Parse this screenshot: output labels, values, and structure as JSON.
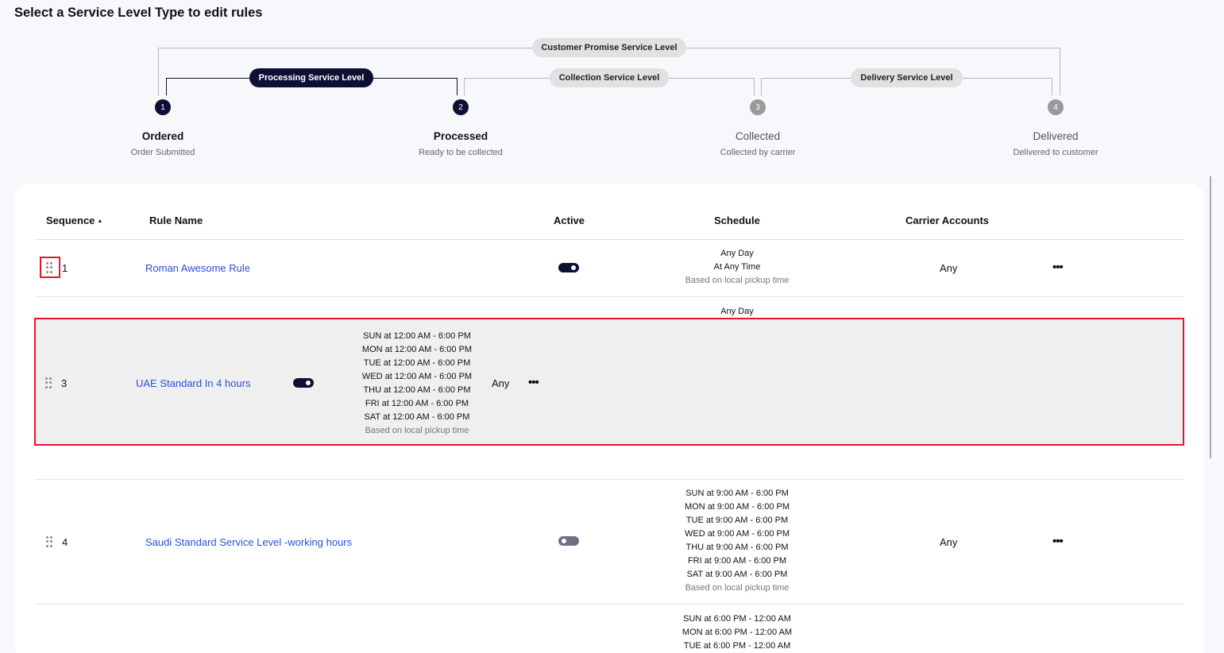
{
  "page": {
    "title": "Select a Service Level Type to edit rules"
  },
  "stepper": {
    "outer_pill": "Customer Promise Service Level",
    "pills": [
      "Processing Service Level",
      "Collection Service Level",
      "Delivery Service Level"
    ],
    "steps": [
      {
        "num": "1",
        "label": "Ordered",
        "sub": "Order Submitted",
        "state": "done"
      },
      {
        "num": "2",
        "label": "Processed",
        "sub": "Ready to be collected",
        "state": "done"
      },
      {
        "num": "3",
        "label": "Collected",
        "sub": "Collected by carrier",
        "state": "todo"
      },
      {
        "num": "4",
        "label": "Delivered",
        "sub": "Delivered to customer",
        "state": "todo"
      }
    ],
    "colors": {
      "active": "#0d1033",
      "inactive": "#9a9a9a"
    }
  },
  "table": {
    "headers": {
      "sequence": "Sequence",
      "rule_name": "Rule Name",
      "active": "Active",
      "schedule": "Schedule",
      "carrier_accounts": "Carrier Accounts"
    },
    "rows": [
      {
        "seq": "1",
        "name": "Roman Awesome Rule",
        "active": true,
        "schedule": [
          "Any Day",
          "At Any Time"
        ],
        "note": "Based on local pickup time",
        "carrier": "Any"
      },
      {
        "seq": "4",
        "name": "Saudi Standard Service Level -working hours",
        "active": false,
        "schedule": [
          "SUN at 9:00 AM - 6:00 PM",
          "MON at 9:00 AM - 6:00 PM",
          "TUE at 9:00 AM - 6:00 PM",
          "WED at 9:00 AM - 6:00 PM",
          "THU at 9:00 AM - 6:00 PM",
          "FRI at 9:00 AM - 6:00 PM",
          "SAT at 9:00 AM - 6:00 PM"
        ],
        "note": "Based on local pickup time",
        "carrier": "Any"
      },
      {
        "schedule": [
          "SUN at 6:00 PM - 12:00 AM",
          "MON at 6:00 PM - 12:00 AM",
          "TUE at 6:00 PM - 12:00 AM"
        ]
      }
    ],
    "placeholder_peek": "Any Day",
    "dragging": {
      "seq": "3",
      "name": "UAE Standard In 4 hours",
      "active": true,
      "schedule": [
        "SUN at 12:00 AM - 6:00 PM",
        "MON at 12:00 AM - 6:00 PM",
        "TUE at 12:00 AM - 6:00 PM",
        "WED at 12:00 AM - 6:00 PM",
        "THU at 12:00 AM - 6:00 PM",
        "FRI at 12:00 AM - 6:00 PM",
        "SAT at 12:00 AM - 6:00 PM"
      ],
      "note": "Based on local pickup time",
      "carrier": "Any"
    },
    "link_color": "#2b50d8",
    "highlight_color": "#e0182d"
  }
}
